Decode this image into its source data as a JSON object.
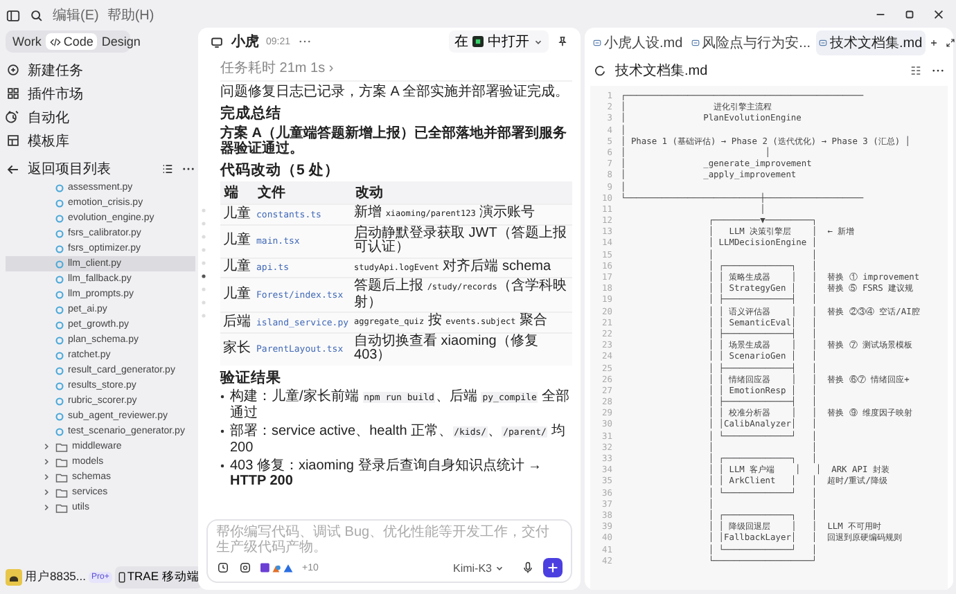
{
  "menu": [
    {
      "label": "编辑(E)"
    },
    {
      "label": "帮助(H)"
    }
  ],
  "modes": [
    {
      "label": "Work",
      "selected": false,
      "kind": "plain"
    },
    {
      "label": "Code",
      "selected": true,
      "kind": "code"
    },
    {
      "label": "Design",
      "selected": false,
      "kind": "plain"
    }
  ],
  "nav": [
    {
      "label": "新建任务",
      "kind": "new"
    },
    {
      "label": "插件市场",
      "kind": "market"
    },
    {
      "label": "自动化",
      "kind": "auto"
    },
    {
      "label": "模板库",
      "kind": "template"
    }
  ],
  "project": {
    "back_label": "返回项目列表"
  },
  "files": [
    {
      "name": "assessment.py",
      "selected": false
    },
    {
      "name": "emotion_crisis.py",
      "selected": false
    },
    {
      "name": "evolution_engine.py",
      "selected": false
    },
    {
      "name": "fsrs_calibrator.py",
      "selected": false
    },
    {
      "name": "fsrs_optimizer.py",
      "selected": false
    },
    {
      "name": "llm_client.py",
      "selected": true
    },
    {
      "name": "llm_fallback.py",
      "selected": false
    },
    {
      "name": "llm_prompts.py",
      "selected": false
    },
    {
      "name": "pet_ai.py",
      "selected": false
    },
    {
      "name": "pet_growth.py",
      "selected": false
    },
    {
      "name": "plan_schema.py",
      "selected": false
    },
    {
      "name": "ratchet.py",
      "selected": false
    },
    {
      "name": "result_card_generator.py",
      "selected": false
    },
    {
      "name": "results_store.py",
      "selected": false
    },
    {
      "name": "rubric_scorer.py",
      "selected": false
    },
    {
      "name": "sub_agent_reviewer.py",
      "selected": false
    },
    {
      "name": "test_scenario_generator.py",
      "selected": false
    }
  ],
  "folders": [
    {
      "name": "middleware",
      "expanded": false
    },
    {
      "name": "models",
      "expanded": false
    },
    {
      "name": "schemas",
      "expanded": false
    },
    {
      "name": "services",
      "expanded": false
    },
    {
      "name": "utils",
      "expanded": false
    }
  ],
  "user": {
    "name": "用户8835...",
    "plan": "Pro+",
    "mobile_button": "TRAE 移动端"
  },
  "chat": {
    "author": "小虎",
    "time": "09:21",
    "open_in": {
      "prefix": "在",
      "suffix": "中打开"
    },
    "duration": "任务耗时 21m 1s ›",
    "intro": "问题修复日志已记录，方案 A 全部实施并部署验证完成。",
    "summary_heading": "完成总结",
    "summary": "方案 A（儿童端答题新增上报）已全部落地并部署到服务器验证通过。",
    "changes_heading": "代码改动（5 处）",
    "table": {
      "columns": [
        "端",
        "文件",
        "改动"
      ],
      "rows": [
        {
          "side": "儿童",
          "file": "constants.ts",
          "change": [
            {
              "text": "新增 ",
              "kind": "text"
            },
            {
              "text": "xiaoming/parent123",
              "kind": "code"
            },
            {
              "text": " 演示账号",
              "kind": "text"
            }
          ]
        },
        {
          "side": "儿童",
          "file": "main.tsx",
          "change": [
            {
              "text": "启动静默登录获取 JWT（答题上报可认证）",
              "kind": "text"
            }
          ]
        },
        {
          "side": "儿童",
          "file": "api.ts",
          "change": [
            {
              "text": "studyApi.logEvent",
              "kind": "code"
            },
            {
              "text": " 对齐后端 schema",
              "kind": "text"
            }
          ]
        },
        {
          "side": "儿童",
          "file": "Forest/index.tsx",
          "change": [
            {
              "text": "答题后上报 ",
              "kind": "text"
            },
            {
              "text": "/study/records",
              "kind": "code"
            },
            {
              "text": "（含学科映射）",
              "kind": "text"
            }
          ]
        },
        {
          "side": "后端",
          "file": "island_service.py",
          "change": [
            {
              "text": "aggregate_quiz",
              "kind": "code"
            },
            {
              "text": " 按 ",
              "kind": "text"
            },
            {
              "text": "events.subject",
              "kind": "code"
            },
            {
              "text": " 聚合",
              "kind": "text"
            }
          ]
        },
        {
          "side": "家长",
          "file": "ParentLayout.tsx",
          "change": [
            {
              "text": "自动切换查看 xiaoming（修复 403）",
              "kind": "text"
            }
          ]
        }
      ]
    },
    "verify_heading": "验证结果",
    "bullets": [
      [
        {
          "text": "构建：儿童/家长前端 ",
          "kind": "text"
        },
        {
          "text": "npm run build",
          "kind": "code"
        },
        {
          "text": "、后端 ",
          "kind": "text"
        },
        {
          "text": "py_compile",
          "kind": "code"
        },
        {
          "text": " 全部通过",
          "kind": "text"
        }
      ],
      [
        {
          "text": "部署：service active、health 正常、",
          "kind": "text"
        },
        {
          "text": "/kids/",
          "kind": "code"
        },
        {
          "text": "、",
          "kind": "text"
        },
        {
          "text": "/parent/",
          "kind": "code"
        },
        {
          "text": " 均 200",
          "kind": "text"
        }
      ],
      [
        {
          "text": "403 修复：xiaoming 登录后查询自身知识点统计 → ",
          "kind": "text"
        },
        {
          "text": "HTTP 200",
          "kind": "strong"
        }
      ]
    ]
  },
  "composer": {
    "placeholder": "帮你编写代码、调试 Bug、优化性能等开发工作，交付生产级代码产物。",
    "extra_count": "+10",
    "model": "Kimi-K3"
  },
  "editor": {
    "tabs": [
      {
        "label": "小虎人设.md",
        "selected": false
      },
      {
        "label": "风险点与行为安...",
        "selected": false
      },
      {
        "label": "技术文档集.md",
        "selected": true
      }
    ],
    "file_title": "技术文档集.md",
    "lines": [
      {
        "number": "1",
        "text": "┌──────────────────────────────────────────────"
      },
      {
        "number": "2",
        "text": "│                 进化引擎主流程"
      },
      {
        "number": "3",
        "text": "│               PlanEvolutionEngine"
      },
      {
        "number": "4",
        "text": "│"
      },
      {
        "number": "5",
        "text": "│ Phase 1 (基础评估) → Phase 2 (迭代优化) → Phase 3 (汇总) │"
      },
      {
        "number": "6",
        "text": "│                           │"
      },
      {
        "number": "7",
        "text": "│               _generate_improvement"
      },
      {
        "number": "8",
        "text": "│               _apply_improvement"
      },
      {
        "number": "9",
        "text": "│"
      },
      {
        "number": "10",
        "text": "└──────────────────────────┼───────────────────"
      },
      {
        "number": "11",
        "text": "                           │"
      },
      {
        "number": "12",
        "text": "                 ┌─────────▼─────────┐"
      },
      {
        "number": "13",
        "text": "                 │   LLM 决策引擎层    │  ← 新增"
      },
      {
        "number": "14",
        "text": "                 │ LLMDecisionEngine │"
      },
      {
        "number": "15",
        "text": "                 │                   │"
      },
      {
        "number": "16",
        "text": "                 │ ┌─────────────┐   │"
      },
      {
        "number": "17",
        "text": "                 │ │ 策略生成器    │   │  替换 ① improvement"
      },
      {
        "number": "18",
        "text": "                 │ │ StrategyGen │   │  替换 ⑤ FSRS 建议规"
      },
      {
        "number": "19",
        "text": "                 │ ├─────────────┤   │"
      },
      {
        "number": "20",
        "text": "                 │ │ 语义评估器    │   │  替换 ②③④ 空话/AI腔"
      },
      {
        "number": "21",
        "text": "                 │ │ SemanticEval│   │"
      },
      {
        "number": "22",
        "text": "                 │ ├─────────────┤   │"
      },
      {
        "number": "23",
        "text": "                 │ │ 场景生成器    │   │  替换 ⑦ 测试场景模板"
      },
      {
        "number": "24",
        "text": "                 │ │ ScenarioGen │   │"
      },
      {
        "number": "25",
        "text": "                 │ ├─────────────┤   │"
      },
      {
        "number": "26",
        "text": "                 │ │ 情绪回应器    │   │  替换 ⑥⑦ 情绪回应+"
      },
      {
        "number": "27",
        "text": "                 │ │ EmotionResp │   │"
      },
      {
        "number": "28",
        "text": "                 │ ├─────────────┤   │"
      },
      {
        "number": "29",
        "text": "                 │ │ 校准分析器    │   │  替换 ⑨ 维度因子映射"
      },
      {
        "number": "30",
        "text": "                 │ │CalibAnalyzer│   │"
      },
      {
        "number": "31",
        "text": "                 │ └─────────────┘   │"
      },
      {
        "number": "32",
        "text": "                 │                   │"
      },
      {
        "number": "33",
        "text": "                 │ ┌─────────────┐   │"
      },
      {
        "number": "34",
        "text": "                 │ │ LLM 客户端    │   │  ARK API 封装"
      },
      {
        "number": "35",
        "text": "                 │ │ ArkClient   │   │  超时/重试/降级"
      },
      {
        "number": "36",
        "text": "                 │ └─────────────┘   │"
      },
      {
        "number": "37",
        "text": "                 │                   │"
      },
      {
        "number": "38",
        "text": "                 │ ┌─────────────┐   │"
      },
      {
        "number": "39",
        "text": "                 │ │ 降级回退层    │   │  LLM 不可用时"
      },
      {
        "number": "40",
        "text": "                 │ │FallbackLayer│   │  回退到原硬编码规则"
      },
      {
        "number": "41",
        "text": "                 │ └─────────────┘   │"
      },
      {
        "number": "42",
        "text": "                 └───────────────────┘"
      }
    ]
  }
}
